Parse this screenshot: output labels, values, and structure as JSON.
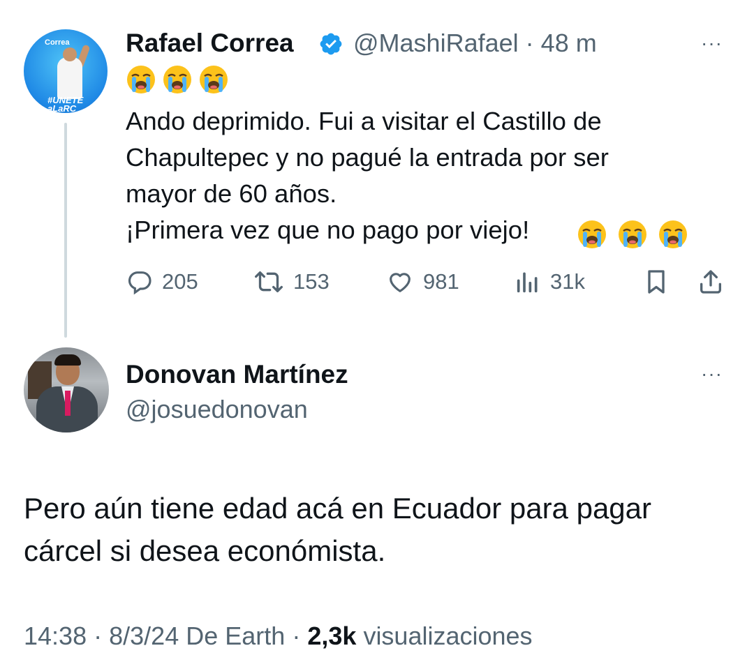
{
  "tweet": {
    "author_name": "Rafael Correa",
    "handle": "@MashiRafael",
    "separator": "·",
    "time": "48 m",
    "more": "···",
    "avatar_text": {
      "top": "Correa",
      "tag": "#UNETE\naLaRC"
    },
    "lead_emojis": [
      "😭",
      "😭",
      "😭"
    ],
    "text_lines": "Ando deprimido. Fui a visitar el Castillo de\nChapultepec y no pagué la entrada por ser\nmayor de 60 años.\n¡Primera vez que no pago por viejo!",
    "trailing_emojis": [
      "😭",
      "😭",
      "😭"
    ],
    "stats": {
      "replies": "205",
      "reposts": "153",
      "likes": "981",
      "views": "31k"
    },
    "icons": [
      "reply-icon",
      "repost-icon",
      "like-icon",
      "views-icon",
      "bookmark-icon",
      "share-icon"
    ],
    "verified_color": "#1d9bf0"
  },
  "reply": {
    "author_name": "Donovan Martínez",
    "handle": "@josuedonovan",
    "more": "···",
    "text": "Pero aún tiene edad acá en Ecuador para pagar\ncárcel si desea económista.",
    "meta": {
      "time": "14:38",
      "sep": "·",
      "date": "8/3/24",
      "source": "De Earth",
      "views_count": "2,3k",
      "views_label": "visualizaciones"
    }
  },
  "colors": {
    "text": "#0f1419",
    "secondary": "#536471",
    "thread_line": "#cfd9de",
    "accent": "#1d9bf0"
  }
}
